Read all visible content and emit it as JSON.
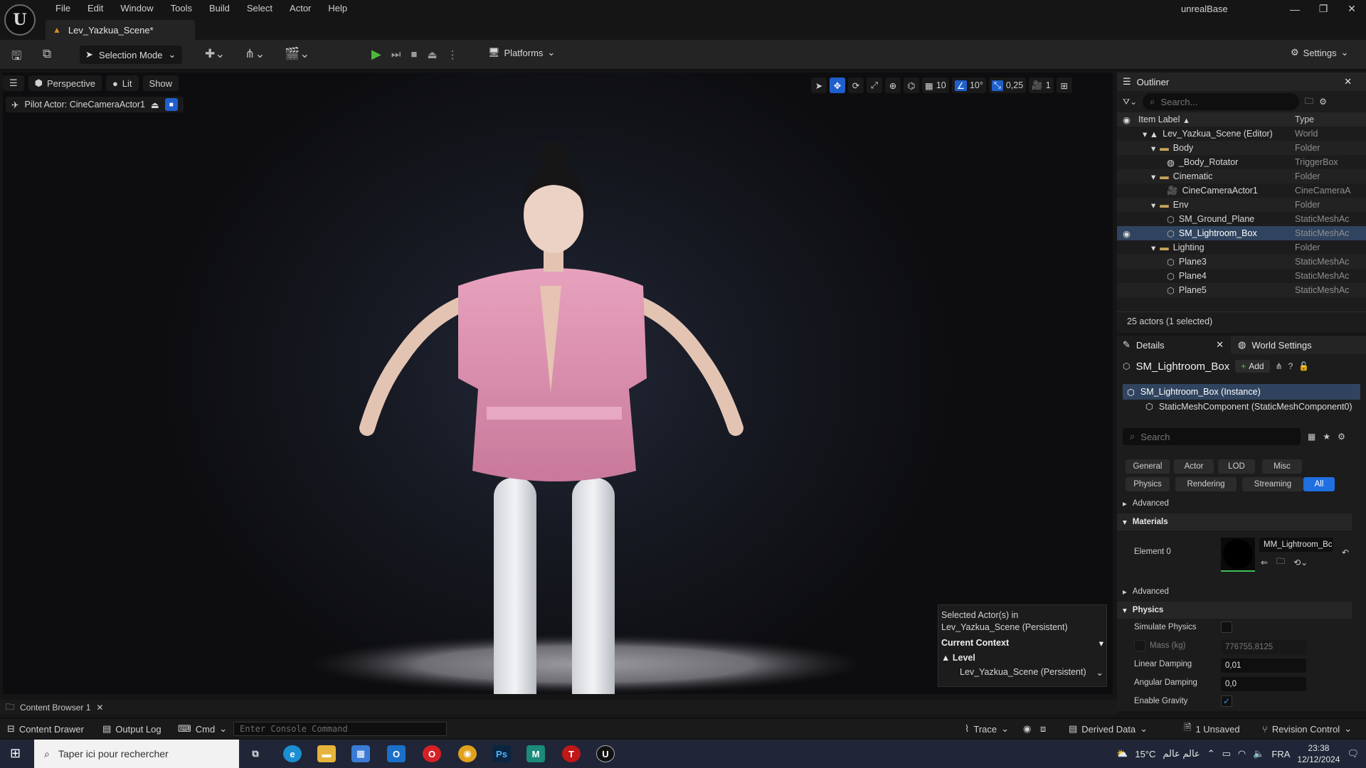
{
  "menu": [
    "File",
    "Edit",
    "Window",
    "Tools",
    "Build",
    "Select",
    "Actor",
    "Help"
  ],
  "document_tab": "Lev_Yazkua_Scene*",
  "project_name": "unrealBase",
  "toolbar": {
    "selection_mode": "Selection Mode",
    "platforms": "Platforms",
    "settings": "Settings"
  },
  "viewport": {
    "perspective": "Perspective",
    "lit": "Lit",
    "show": "Show",
    "pilot_actor": "Pilot Actor: CineCameraActor1",
    "grid_snap": "10",
    "rotation_snap": "10°",
    "scale_snap": "0,25",
    "camera_speed": "1"
  },
  "context_popup": {
    "line1": "Selected Actor(s) in",
    "line2": "Lev_Yazkua_Scene (Persistent)",
    "header": "Current Context",
    "level_label": "Level",
    "level_value": "Lev_Yazkua_Scene (Persistent)"
  },
  "outliner": {
    "title": "Outliner",
    "search_placeholder": "Search...",
    "col_label": "Item Label",
    "col_type": "Type",
    "rows": [
      {
        "label": "Lev_Yazkua_Scene (Editor)",
        "type": "World"
      },
      {
        "label": "Body",
        "type": "Folder"
      },
      {
        "label": "_Body_Rotator",
        "type": "TriggerBox"
      },
      {
        "label": "Cinematic",
        "type": "Folder"
      },
      {
        "label": "CineCameraActor1",
        "type": "CineCameraA"
      },
      {
        "label": "Env",
        "type": "Folder"
      },
      {
        "label": "SM_Ground_Plane",
        "type": "StaticMeshAc"
      },
      {
        "label": "SM_Lightroom_Box",
        "type": "StaticMeshAc"
      },
      {
        "label": "Lighting",
        "type": "Folder"
      },
      {
        "label": "Plane3",
        "type": "StaticMeshAc"
      },
      {
        "label": "Plane4",
        "type": "StaticMeshAc"
      },
      {
        "label": "Plane5",
        "type": "StaticMeshAc"
      }
    ],
    "footer": "25 actors (1 selected)"
  },
  "details": {
    "tab": "Details",
    "world_settings_tab": "World Settings",
    "actor_name": "SM_Lightroom_Box",
    "add_label": "Add",
    "instance": "SM_Lightroom_Box (Instance)",
    "component": "StaticMeshComponent (StaticMeshComponent0)",
    "search_placeholder": "Search",
    "filters": [
      "General",
      "Actor",
      "LOD",
      "Misc",
      "Physics",
      "Rendering",
      "Streaming",
      "All"
    ],
    "section_advanced": "Advanced",
    "section_materials": "Materials",
    "element0_label": "Element 0",
    "element0_value": "MM_Lightroom_Bc",
    "section_physics": "Physics",
    "simulate_physics": "Simulate Physics",
    "mass_label": "Mass (kg)",
    "mass_value": "776755,8125",
    "linear_damping_label": "Linear Damping",
    "linear_damping_value": "0,01",
    "angular_damping_label": "Angular Damping",
    "angular_damping_value": "0,0",
    "enable_gravity": "Enable Gravity"
  },
  "bottom": {
    "content_browser_tab": "Content Browser 1",
    "content_drawer": "Content Drawer",
    "output_log": "Output Log",
    "cmd": "Cmd",
    "console_placeholder": "Enter Console Command",
    "trace": "Trace",
    "derived_data": "Derived Data",
    "unsaved": "1 Unsaved",
    "revision_control": "Revision Control"
  },
  "taskbar": {
    "search_placeholder": "Taper ici pour rechercher",
    "weather": "15°C",
    "weather_text": "عالم عالم",
    "lang": "FRA",
    "time": "23:38",
    "date": "12/12/2024"
  }
}
